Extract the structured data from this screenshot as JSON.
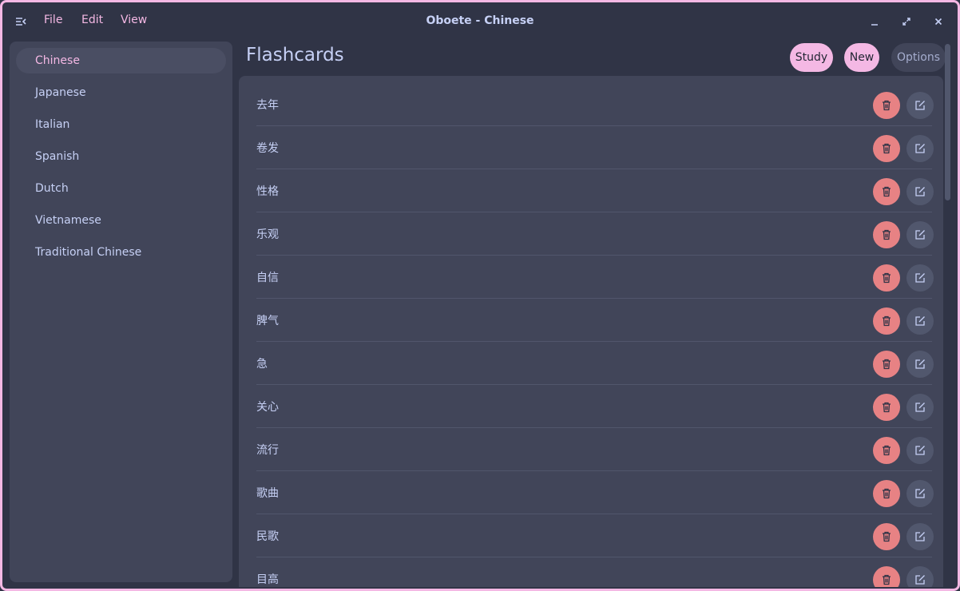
{
  "titlebar": {
    "title": "Oboete - Chinese",
    "menu": [
      "File",
      "Edit",
      "View"
    ]
  },
  "sidebar": {
    "items": [
      {
        "label": "Chinese",
        "active": true
      },
      {
        "label": "Japanese"
      },
      {
        "label": "Italian"
      },
      {
        "label": "Spanish"
      },
      {
        "label": "Dutch"
      },
      {
        "label": "Vietnamese"
      },
      {
        "label": "Traditional Chinese"
      }
    ]
  },
  "main": {
    "title": "Flashcards",
    "actions": {
      "study": "Study",
      "new": "New",
      "options": "Options"
    },
    "cards": [
      "去年",
      "卷发",
      "性格",
      "乐观",
      "自信",
      "脾气",
      "急",
      "关心",
      "流行",
      "歌曲",
      "民歌",
      "目高"
    ]
  },
  "colors": {
    "accent": "#f4b8e4",
    "delete": "#e78284",
    "surface": "#414559",
    "background": "#303446",
    "text": "#c6d0f5"
  },
  "icons": {
    "menu_toggle": "sidebar-toggle-icon",
    "minimize": "minimize-icon",
    "maximize": "maximize-icon",
    "close": "close-icon",
    "delete": "trash-icon",
    "edit": "edit-icon"
  }
}
